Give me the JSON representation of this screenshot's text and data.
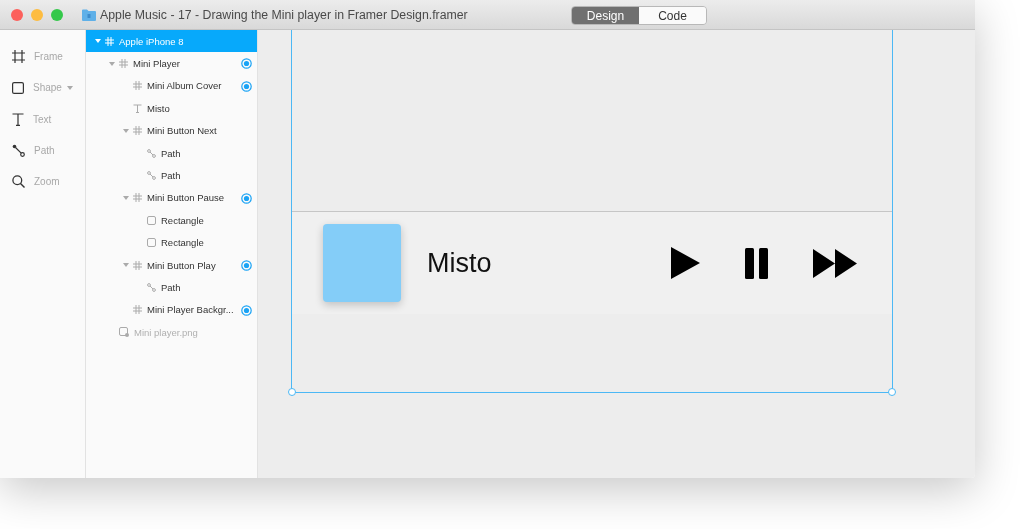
{
  "window": {
    "title": "Apple Music - 17 - Drawing the Mini player in Framer Design.framer"
  },
  "mode_tabs": [
    {
      "label": "Design",
      "selected": true
    },
    {
      "label": "Code",
      "selected": false
    }
  ],
  "tools": [
    {
      "label": "Frame",
      "kind": "frame",
      "has_menu": false
    },
    {
      "label": "Shape",
      "kind": "shape",
      "has_menu": true
    },
    {
      "label": "Text",
      "kind": "text",
      "has_menu": false
    },
    {
      "label": "Path",
      "kind": "path",
      "has_menu": false
    },
    {
      "label": "Zoom",
      "kind": "zoom",
      "has_menu": false
    }
  ],
  "layers": [
    {
      "name": "Apple iPhone 8",
      "kind": "frame",
      "selected": true,
      "expanded": true,
      "targeted": false,
      "visible": true,
      "children": [
        {
          "name": "Mini Player",
          "kind": "frame",
          "selected": false,
          "expanded": true,
          "targeted": true,
          "visible": true,
          "children": [
            {
              "name": "Mini Album Cover",
              "kind": "frame",
              "selected": false,
              "targeted": true,
              "visible": true
            },
            {
              "name": "Misto",
              "kind": "text",
              "selected": false,
              "targeted": false,
              "visible": true
            },
            {
              "name": "Mini Button Next",
              "kind": "frame",
              "selected": false,
              "expanded": true,
              "targeted": false,
              "visible": true,
              "children": [
                {
                  "name": "Path",
                  "kind": "path",
                  "selected": false,
                  "targeted": false,
                  "visible": true
                },
                {
                  "name": "Path",
                  "kind": "path",
                  "selected": false,
                  "targeted": false,
                  "visible": true
                }
              ]
            },
            {
              "name": "Mini Button Pause",
              "kind": "frame",
              "selected": false,
              "expanded": true,
              "targeted": true,
              "visible": true,
              "children": [
                {
                  "name": "Rectangle",
                  "kind": "rect",
                  "selected": false,
                  "targeted": false,
                  "visible": true
                },
                {
                  "name": "Rectangle",
                  "kind": "rect",
                  "selected": false,
                  "targeted": false,
                  "visible": true
                }
              ]
            },
            {
              "name": "Mini Button Play",
              "kind": "frame",
              "selected": false,
              "expanded": true,
              "targeted": true,
              "visible": true,
              "children": [
                {
                  "name": "Path",
                  "kind": "path",
                  "selected": false,
                  "targeted": false,
                  "visible": true
                }
              ]
            },
            {
              "name": "Mini Player Backgr...",
              "kind": "frame",
              "selected": false,
              "targeted": true,
              "visible": true
            }
          ]
        },
        {
          "name": "Mini player.png",
          "kind": "image",
          "selected": false,
          "targeted": false,
          "visible": false
        }
      ]
    }
  ],
  "mini_player": {
    "song": "Misto",
    "controls": [
      {
        "kind": "play"
      },
      {
        "kind": "pause"
      },
      {
        "kind": "next"
      }
    ]
  }
}
